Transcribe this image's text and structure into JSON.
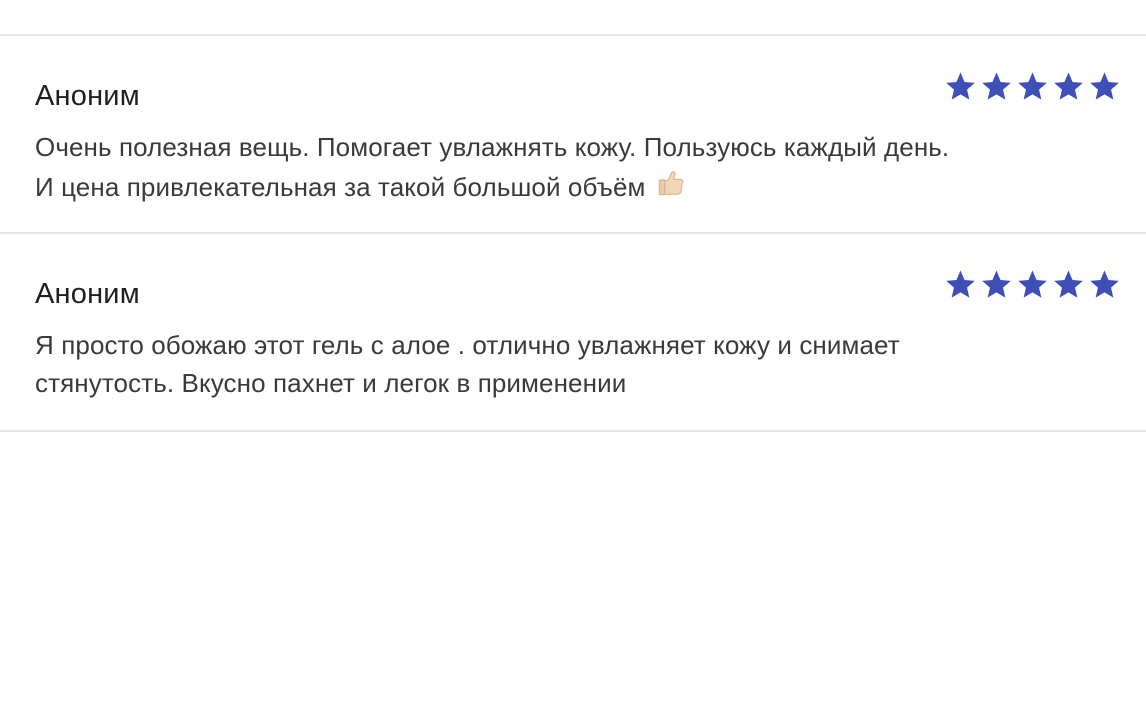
{
  "reviews": [
    {
      "author": "Аноним",
      "rating": 5,
      "lines": [
        "Очень полезная вещь. Помогает увлажнять кожу. Пользуюсь каждый день.",
        "И цена привлекательная за такой большой объём"
      ],
      "trailing_icon": "thumbs-up-icon"
    },
    {
      "author": "Аноним",
      "rating": 5,
      "lines": [
        "Я просто обожаю этот гель с алое . отлично увлажняет кожу и снимает",
        "стянутость. Вкусно пахнет и легок в применении"
      ]
    }
  ],
  "colors": {
    "star": "#3f4fb8",
    "divider": "#e6e6e6",
    "text": "#3a3a3a",
    "author": "#1f1f1f"
  },
  "icons": {
    "star": "star-icon",
    "thumbs": "thumbs-up-icon"
  }
}
